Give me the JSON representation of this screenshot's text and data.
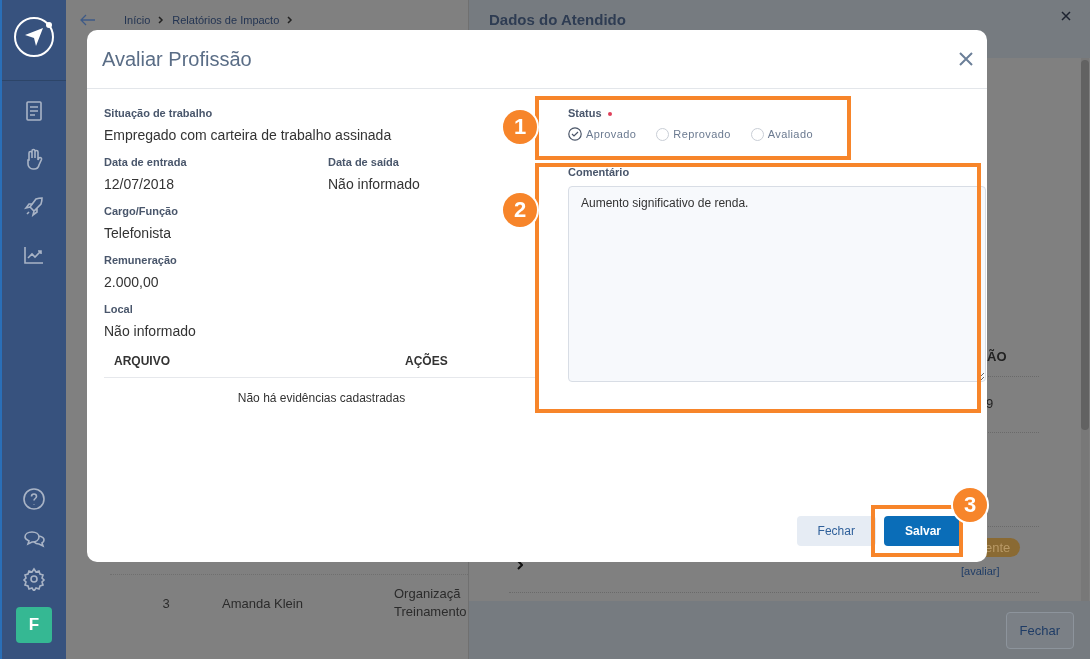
{
  "sidebar": {
    "avatar": "F"
  },
  "breadcrumb": [
    {
      "label": "Início"
    },
    {
      "label": "Relatórios de Impacto"
    }
  ],
  "background_table": {
    "rows": [
      {
        "cells": [
          "3",
          "Amanda Klein",
          "Organizaçã\nTreinamento"
        ]
      }
    ]
  },
  "drawer": {
    "title": "Dados do Atendido",
    "column_header": "ÃO",
    "cell": "9",
    "badge": "ente",
    "link": "[avaliar]",
    "close_button": "Fechar"
  },
  "dialog": {
    "title": "Avaliar Profissão",
    "field_rows": [
      [
        {
          "label": "Situação de trabalho",
          "value": "Empregado com carteira de trabalho assinada"
        }
      ],
      [
        {
          "label": "Data de entrada",
          "value": "12/07/2018"
        },
        {
          "label": "Data de saída",
          "value": "Não informado"
        }
      ],
      [
        {
          "label": "Cargo/Função",
          "value": "Telefonista"
        }
      ],
      [
        {
          "label": "Remuneração",
          "value": "2.000,00"
        }
      ],
      [
        {
          "label": "Local",
          "value": "Não informado"
        }
      ]
    ],
    "files_table": {
      "columns": [
        "ARQUIVO",
        "AÇÕES"
      ],
      "empty_message": "Não há evidências cadastradas"
    },
    "status": {
      "label": "Status",
      "required": true,
      "options": [
        {
          "label": "Aprovado",
          "selected": true
        },
        {
          "label": "Reprovado",
          "selected": false
        },
        {
          "label": "Avaliado",
          "selected": false
        }
      ]
    },
    "comment": {
      "label": "Comentário",
      "value": "Aumento significativo de renda."
    },
    "buttons": [
      {
        "label": "Fechar",
        "kind": "secondary"
      },
      {
        "label": "Salvar",
        "kind": "primary"
      }
    ]
  },
  "annotations": [
    {
      "number": "1"
    },
    {
      "number": "2"
    },
    {
      "number": "3"
    }
  ]
}
